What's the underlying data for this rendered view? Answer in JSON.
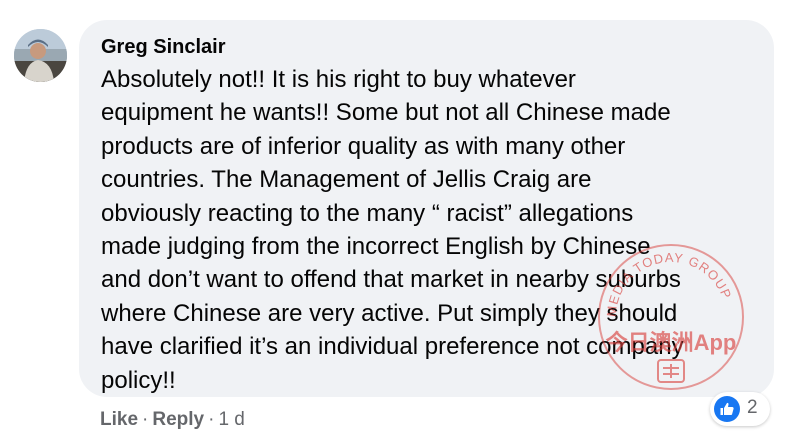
{
  "comment": {
    "author": "Greg Sinclair",
    "text": "Absolutely not!! It is his right to buy whatever\nequipment he wants!! Some but not all Chinese made\nproducts are of inferior quality as with many other\ncountries. The Management of Jellis Craig are\nobviously reacting to the many “ racist” allegations\nmade judging from the incorrect English by Chinese\nand don’t want to offend that market in nearby suburbs\nwhere Chinese are very active. Put simply they should\nhave clarified it’s an individual preference not company\npolicy!!",
    "avatar_icon": "profile-photo"
  },
  "actions": {
    "like_label": "Like",
    "reply_label": "Reply",
    "separator": "·",
    "timestamp": "1 d"
  },
  "reactions": {
    "icon": "thumbs-up-icon",
    "count": "2"
  },
  "watermark": {
    "ring_text": "MEDIA TODAY GROUP",
    "main_text": "今日澳洲App"
  },
  "colors": {
    "bubble": "#f0f2f5",
    "like_blue": "#1877f2",
    "meta_gray": "#65676b",
    "watermark_red": "#d9413c"
  }
}
